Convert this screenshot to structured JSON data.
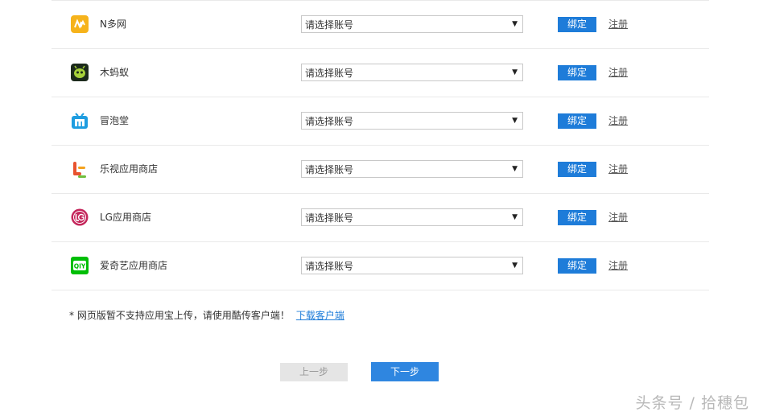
{
  "stores": [
    {
      "name": "N多网",
      "icon": "nduo-icon",
      "select_value": "请选择账号",
      "bind_label": "绑定",
      "register_label": "注册"
    },
    {
      "name": "木蚂蚁",
      "icon": "mumayi-icon",
      "select_value": "请选择账号",
      "bind_label": "绑定",
      "register_label": "注册"
    },
    {
      "name": "冒泡堂",
      "icon": "maopaotang-icon",
      "select_value": "请选择账号",
      "bind_label": "绑定",
      "register_label": "注册"
    },
    {
      "name": "乐视应用商店",
      "icon": "letv-icon",
      "select_value": "请选择账号",
      "bind_label": "绑定",
      "register_label": "注册"
    },
    {
      "name": "LG应用商店",
      "icon": "lg-icon",
      "select_value": "请选择账号",
      "bind_label": "绑定",
      "register_label": "注册"
    },
    {
      "name": "爱奇艺应用商店",
      "icon": "iqiyi-icon",
      "select_value": "请选择账号",
      "bind_label": "绑定",
      "register_label": "注册"
    }
  ],
  "notice": {
    "text": "* 网页版暂不支持应用宝上传，请使用酷传客户端！",
    "link": "下载客户端"
  },
  "nav": {
    "prev_label": "上一步",
    "next_label": "下一步"
  },
  "watermark": "头条号 / 拾穗包",
  "colors": {
    "accent": "#1e7cd9",
    "next_button": "#2f86e0",
    "prev_button": "#e5e5e5",
    "divider": "#e9e9e9"
  }
}
